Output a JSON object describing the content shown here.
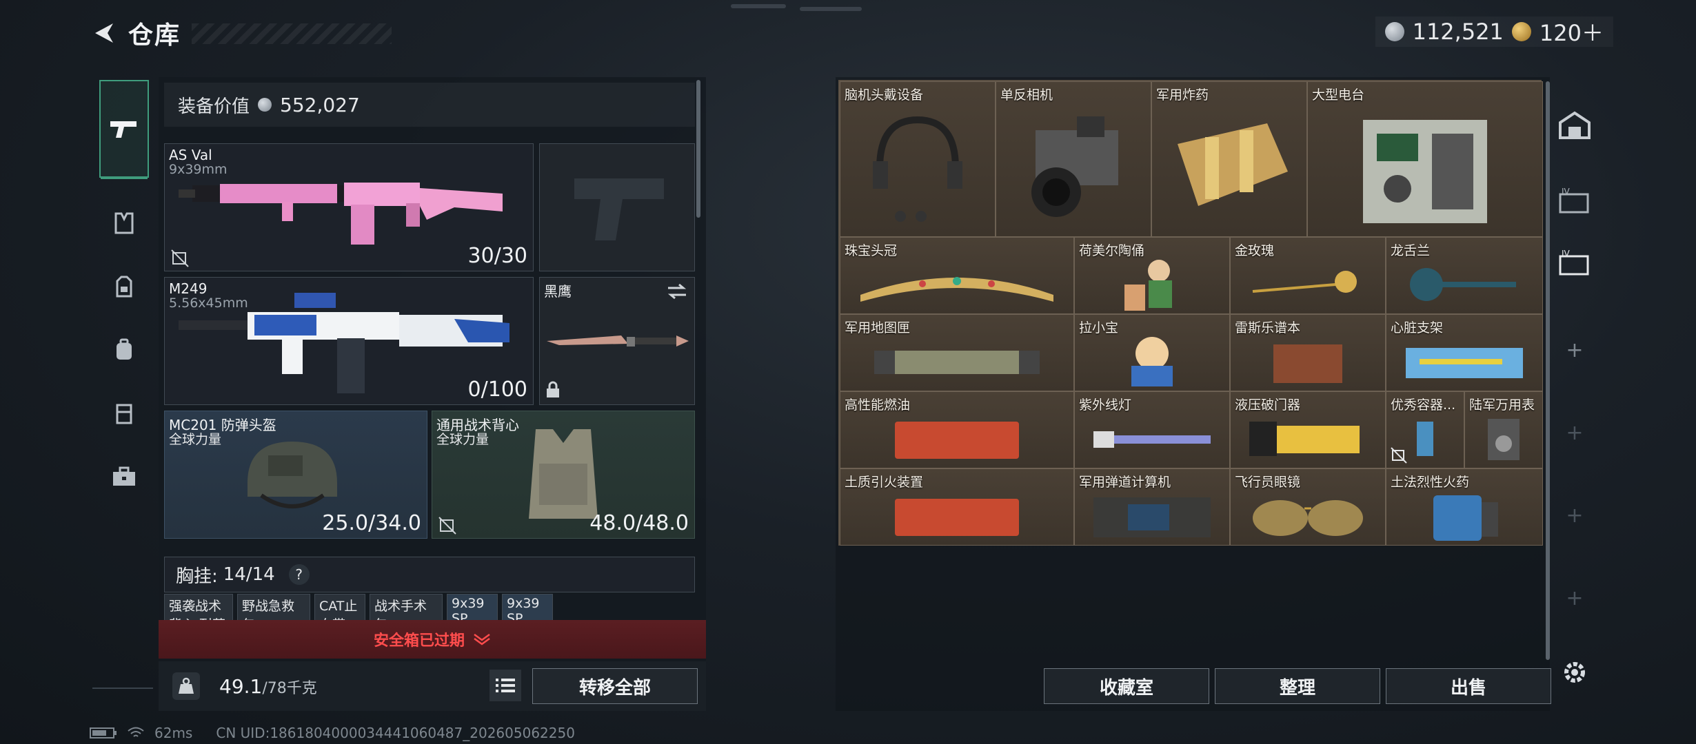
{
  "header": {
    "title": "仓库"
  },
  "currency": {
    "silver": "112,521",
    "gold": "120＋"
  },
  "loadout": {
    "value_label": "装备价值",
    "value": "552,027",
    "primary": {
      "name": "AS Val",
      "caliber": "9x39mm",
      "ammo": "30/30"
    },
    "secondary": {
      "name": "M249",
      "caliber": "5.56x45mm",
      "ammo": "0/100"
    },
    "melee": {
      "name": "黑鹰"
    },
    "helmet": {
      "name": "MC201 防弹头盔",
      "brand": "全球力量",
      "durability": "25.0/34.0"
    },
    "armor": {
      "name": "通用战术背心",
      "brand": "全球力量",
      "durability": "48.0/48.0"
    },
    "rig": {
      "label": "胸挂:",
      "capacity": "14/14"
    },
    "rig_items": [
      "强袭战术背心 耐药",
      "野战急救包",
      "CAT止血带",
      "战术手术包",
      "9x39 SP",
      "9x39 SP"
    ],
    "safe_box": "安全箱已过期",
    "weight": "49.1",
    "weight_max": "/78千克",
    "transfer_all": "转移全部"
  },
  "stash": {
    "items": [
      "脑机头戴设备",
      "单反相机",
      "军用炸药",
      "大型电台",
      "珠宝头冠",
      "荷美尔陶俑",
      "金玫瑰",
      "龙舌兰",
      "军用地图匣",
      "拉小宝",
      "雷斯乐谱本",
      "心脏支架",
      "高性能燃油",
      "紫外线灯",
      "液压破门器",
      "优秀容器...",
      "陆军万用表",
      "土质引火装置",
      "军用弹道计算机",
      "飞行员眼镜",
      "土法烈性火药"
    ],
    "buttons": {
      "collection": "收藏室",
      "sort": "整理",
      "sell": "出售"
    }
  },
  "status_bar": {
    "ping": "62ms",
    "uid": "CN UID:18618040000344410604​87_202605062250"
  },
  "colors": {
    "accent": "#3f9d7d",
    "danger": "#ff4d4d",
    "stash_bg": "#40372d"
  }
}
